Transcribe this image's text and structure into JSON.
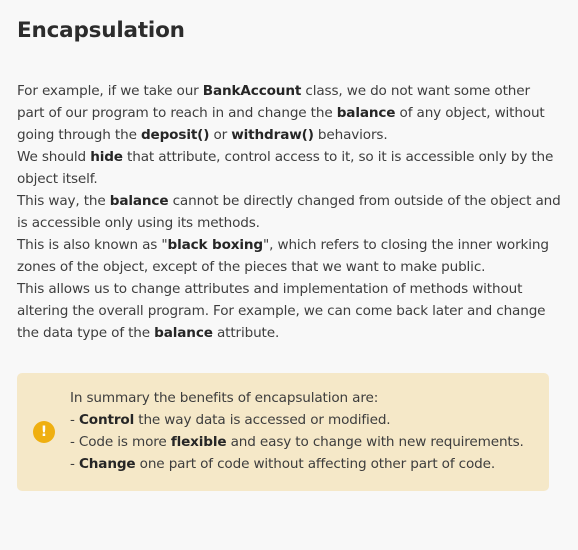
{
  "title": "Encapsulation",
  "paragraphs": [
    {
      "lines": [
        [
          {
            "t": "For example, if we take our ",
            "b": false
          },
          {
            "t": "BankAccount",
            "b": true
          },
          {
            "t": " class, we do not want some other part of our program to reach in and change the ",
            "b": false
          },
          {
            "t": "balance",
            "b": true
          },
          {
            "t": " of any object, without going through the ",
            "b": false
          },
          {
            "t": "deposit()",
            "b": true
          },
          {
            "t": " or ",
            "b": false
          },
          {
            "t": "withdraw()",
            "b": true
          },
          {
            "t": " behaviors.",
            "b": false
          }
        ]
      ]
    },
    {
      "lines": [
        [
          {
            "t": "We should ",
            "b": false
          },
          {
            "t": "hide",
            "b": true
          },
          {
            "t": " that attribute, control access to it, so it is accessible only by the object itself.",
            "b": false
          }
        ]
      ]
    },
    {
      "lines": [
        [
          {
            "t": "This way, the ",
            "b": false
          },
          {
            "t": "balance",
            "b": true
          },
          {
            "t": " cannot be directly changed from outside of the object and is accessible only using its methods.",
            "b": false
          }
        ]
      ]
    },
    {
      "lines": [
        [
          {
            "t": "This is also known as \"",
            "b": false
          },
          {
            "t": "black boxing",
            "b": true
          },
          {
            "t": "\", which refers to closing the inner working zones of the object, except of the pieces that we want to make public.",
            "b": false
          }
        ]
      ]
    },
    {
      "lines": [
        [
          {
            "t": "This allows us to change attributes and implementation of methods without altering the overall program. For example, we can come back later and change the data type of the ",
            "b": false
          },
          {
            "t": "balance",
            "b": true
          },
          {
            "t": " attribute.",
            "b": false
          }
        ]
      ]
    }
  ],
  "callout": {
    "icon": "exclamation-icon",
    "icon_glyph": "!",
    "accent_color": "#efaf10",
    "background_color": "#f5e8c8",
    "lines": [
      [
        {
          "t": "In summary the benefits of encapsulation are:",
          "b": false
        }
      ],
      [
        {
          "t": "- ",
          "b": false
        },
        {
          "t": "Control",
          "b": true
        },
        {
          "t": " the way data is accessed or modified.",
          "b": false
        }
      ],
      [
        {
          "t": "- Code is more ",
          "b": false
        },
        {
          "t": "flexible",
          "b": true
        },
        {
          "t": " and easy to change with new requirements.",
          "b": false
        }
      ],
      [
        {
          "t": "- ",
          "b": false
        },
        {
          "t": "Change",
          "b": true
        },
        {
          "t": " one part of code without affecting other part of code.",
          "b": false
        }
      ]
    ]
  }
}
